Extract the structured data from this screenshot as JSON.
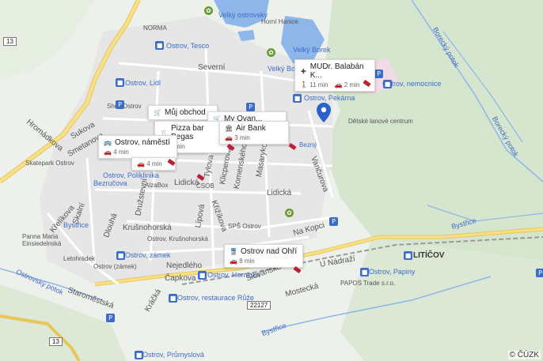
{
  "map": {
    "copyright": "© ČÚZK",
    "labels": {
      "norma": "NORMA",
      "velky_ostrovsky": "Velký ostrovský",
      "horni_hanice": "Horní Hanice",
      "ostrov_tesco": "Ostrov, Tesco",
      "severni": "Severní",
      "velky_borek_bus": "Velký Borek",
      "velky_borek": "Velký Borek",
      "ostrov_lidl": "Ostrov, Lidl",
      "shell": "Shell Ostrov",
      "sukova": "Sukova",
      "smetanova": "Smetanova",
      "hromadkova": "Hromádkova",
      "skatepark": "Skatepark Ostrov",
      "ostrov_polikl": "Ostrov, Poliklinika",
      "bezrucova": "Bezručova",
      "alzabox": "AlzaBox",
      "lidicka1": "Lidická",
      "csob": "ČSOB",
      "lidicka2": "Lidická",
      "druzstevni": "Družstevní",
      "krusnohorska": "Krušnohorská",
      "ostrov_krusnohorska": "Ostrov, Krušnohorská",
      "kfelikova": "Křelíkova",
      "skalni": "Skalní",
      "dlouha": "Dlouhá",
      "panna_maria": "Panna Maria Einsiedelnská",
      "letohradek": "Letohrádek",
      "ostrov_zamek_stop": "Ostrov, zámek",
      "ostrov_zamek": "Ostrov (zámek)",
      "nejedleho": "Nejedlého",
      "capkova": "Čapkova",
      "ostrov_hornicka": "Ostrov, Hornická",
      "ostrovsky_potok": "Ostrovský potok",
      "staromestska": "Staroměstská",
      "ostrov_restaurace": "Ostrov, restaurace Růže",
      "krcka": "Kráčká",
      "ostrov_prumyslova": "Ostrov, Průmyslová",
      "ostrov_pekarna": "Ostrov, Pekárna",
      "ostrov_nemocnice": "Ostrov, nemocnice",
      "detske_lanove": "Dětské lanové centrum",
      "borecky_potok1": "Borecký potok",
      "borecky_potok2": "Borecký potok",
      "tylova": "Tylova",
      "klicperova": "Klicperova",
      "komenskeho": "Komenského",
      "masarykova": "Masarykova",
      "vancurova": "Vančurova",
      "lipova": "Lípová",
      "krizikova": "Křižíkova",
      "sps_ostrov": "SPŠ Ostrov",
      "na_kopci": "Na Kopci",
      "u_nadrazi": "U Nádraží",
      "mostecka": "Mostecká",
      "slovanska": "Slovanská",
      "bystrice1": "Bystřice",
      "bystrice2": "Bystřice",
      "bystrice3": "Bystřice",
      "liticov": "LITÍČOV",
      "ostrov_papiny": "Ostrov, Papiny",
      "papos": "PAPOS Trade s.r.o.",
      "bezny": "Bezný",
      "road_22127": "22127",
      "road_13a": "13",
      "road_13b": "13",
      "road_13c": "13"
    },
    "cards": [
      {
        "title": "MUDr. Balabán K...",
        "icon": "plus-icon",
        "walk": "11 min",
        "drive": "2 min"
      },
      {
        "title": "Můj obchod",
        "icon": "cart-icon"
      },
      {
        "title": "My Ovan...",
        "icon": "cart-icon"
      },
      {
        "title": "Pizza bar Pegas",
        "icon": "fork-icon",
        "drive": "3 min"
      },
      {
        "title": "Air Bank",
        "icon": "bank-icon",
        "drive": "3 min"
      },
      {
        "title": "Ostrov, náměstí",
        "icon": "bus-icon",
        "drive": "4 min"
      },
      {
        "title": "",
        "icon": "",
        "drive": "4 min"
      },
      {
        "title": "Ostrov nad Ohří",
        "icon": "train-icon",
        "drive": "8 min"
      }
    ]
  }
}
